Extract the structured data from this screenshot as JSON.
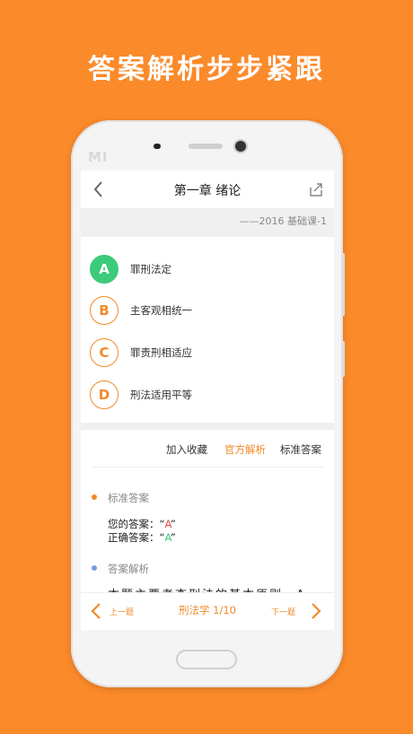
{
  "headline": "答案解析步步紧跟",
  "device": {
    "brand": "MI"
  },
  "nav": {
    "title": "第一章 绪论",
    "back_icon": "chevron-left-icon",
    "share_icon": "share-icon"
  },
  "subheader": {
    "text": "——2016 基础课-1"
  },
  "options": [
    {
      "letter": "A",
      "label": "罪刑法定",
      "selected": true
    },
    {
      "letter": "B",
      "label": "主客观相统一",
      "selected": false
    },
    {
      "letter": "C",
      "label": "罪责刑相适应",
      "selected": false
    },
    {
      "letter": "D",
      "label": "刑法适用平等",
      "selected": false
    }
  ],
  "tabs": [
    {
      "label": "加入收藏",
      "active": false
    },
    {
      "label": "官方解析",
      "active": true
    },
    {
      "label": "标准答案",
      "active": false
    }
  ],
  "standard_answer": {
    "heading": "标准答案",
    "your_answer_label": "您的答案：",
    "your_answer_value": "A",
    "correct_answer_label": "正确答案：",
    "correct_answer_value": "A"
  },
  "analysis": {
    "heading": "答案解析",
    "partial_text": "本题主要考查刑法的基本原则。A"
  },
  "bottom_bar": {
    "prev_label": "上一题",
    "center_label": "刑法学 1/10",
    "next_label": "下一题"
  },
  "colors": {
    "background": "#FB8A2A",
    "accent": "#F08A2A",
    "selected": "#3CCB7A",
    "wrong": "#E84B4B"
  }
}
